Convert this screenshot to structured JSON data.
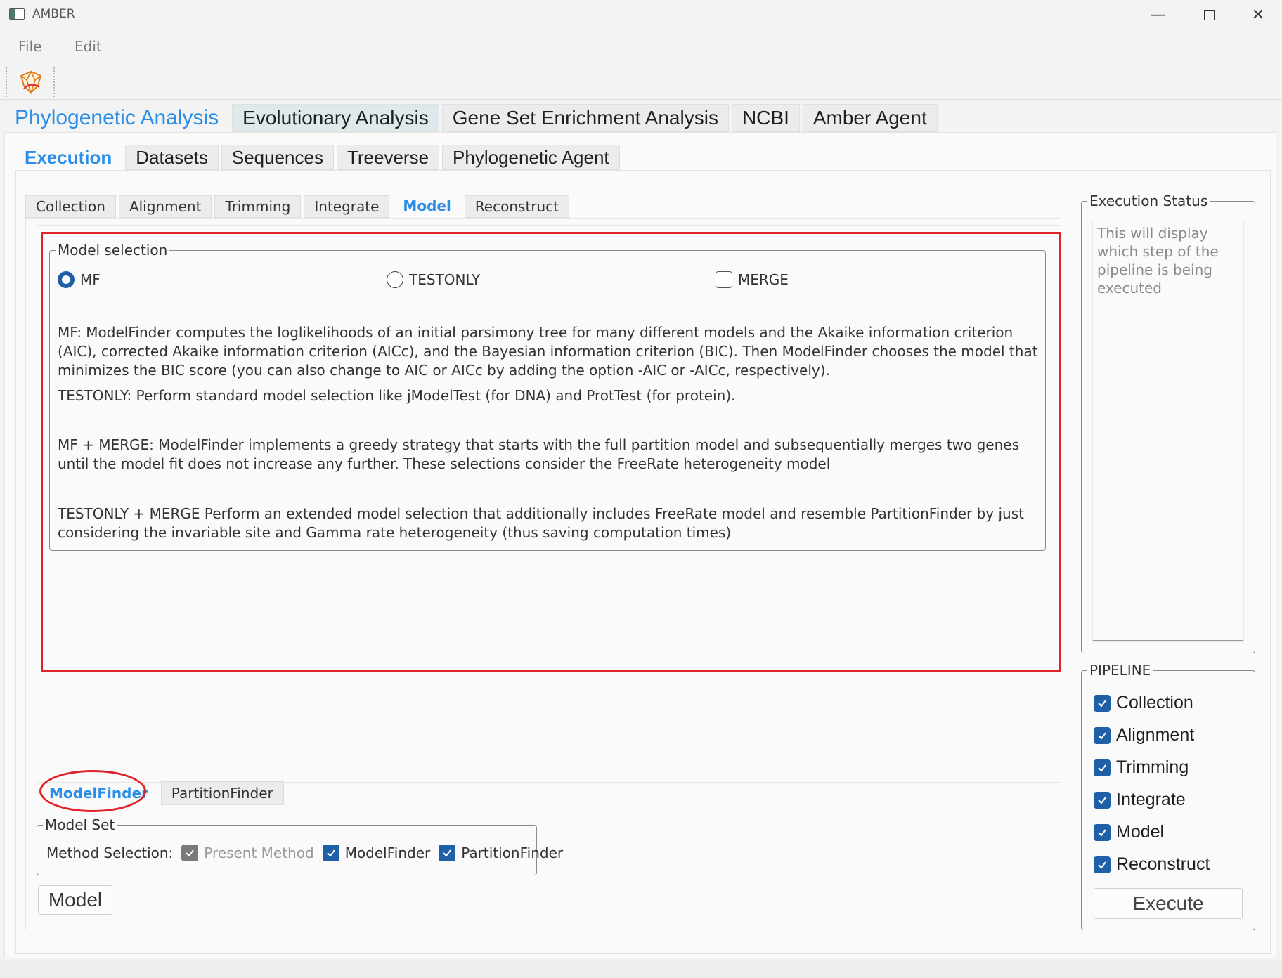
{
  "window": {
    "title": "AMBER",
    "controls": {
      "minimize": "—",
      "close": "✕"
    }
  },
  "menu": {
    "file": "File",
    "edit": "Edit"
  },
  "main_tabs": [
    "Phylogenetic Analysis",
    "Evolutionary Analysis",
    "Gene Set Enrichment Analysis",
    "NCBI",
    "Amber Agent"
  ],
  "sub_tabs": [
    "Execution",
    "Datasets",
    "Sequences",
    "Treeverse",
    "Phylogenetic Agent"
  ],
  "step_tabs": [
    "Collection",
    "Alignment",
    "Trimming",
    "Integrate",
    "Model",
    "Reconstruct"
  ],
  "model_selection": {
    "legend": "Model selection",
    "options": {
      "mf": "MF",
      "testonly": "TESTONLY",
      "merge": "MERGE"
    },
    "selected": "MF",
    "merge_checked": false,
    "descriptions": [
      "MF: ModelFinder computes the loglikelihoods of an initial parsimony tree for many different models and the Akaike information criterion (AIC), corrected Akaike information criterion (AICc), and the Bayesian information criterion (BIC). Then ModelFinder chooses the model that minimizes the BIC score (you can also change to AIC or AICc by adding the option -AIC or -AICc, respectively).",
      "TESTONLY: Perform standard model selection like jModelTest (for DNA) and ProtTest (for protein).",
      "MF + MERGE: ModelFinder implements a greedy strategy that starts with the full partition model and subsequentially merges two genes until the model fit does not increase any further. These selections consider the FreeRate heterogeneity model",
      "TESTONLY + MERGE  Perform an extended model selection that additionally includes FreeRate model and resemble PartitionFinder by just considering the invariable site and Gamma rate heterogeneity (thus saving computation times)"
    ]
  },
  "bottom_tabs": [
    "ModelFinder",
    "PartitionFinder"
  ],
  "model_set": {
    "legend": "Model Set",
    "method_label": "Method Selection:",
    "options": [
      "Present Method",
      "ModelFinder",
      "PartitionFinder"
    ]
  },
  "model_button": "Model",
  "execution_status": {
    "legend": "Execution Status",
    "placeholder": "This will display which step of the pipeline is being executed"
  },
  "pipeline": {
    "legend": "PIPELINE",
    "items": [
      "Collection",
      "Alignment",
      "Trimming",
      "Integrate",
      "Model",
      "Reconstruct"
    ],
    "execute": "Execute"
  },
  "colors": {
    "accent": "#2a8ee8",
    "checkbox": "#1e5fa8",
    "highlight": "#e0232a"
  }
}
